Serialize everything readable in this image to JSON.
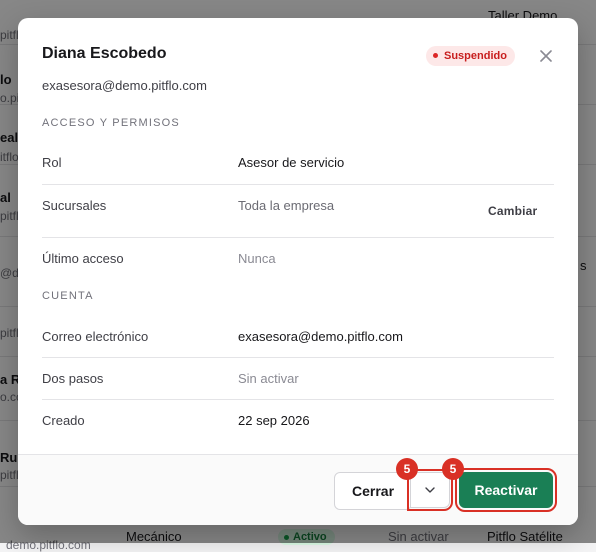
{
  "background": {
    "fragments": [
      {
        "id": "bg-top-right",
        "text": "Taller Demo"
      },
      {
        "id": "bg-l1",
        "text": "pitflo"
      },
      {
        "id": "bg-l2",
        "text": "lo"
      },
      {
        "id": "bg-l3",
        "text": "o.pitflo"
      },
      {
        "id": "bg-l4",
        "text": "eal"
      },
      {
        "id": "bg-l5",
        "text": "itflo"
      },
      {
        "id": "bg-l6",
        "text": "al"
      },
      {
        "id": "bg-l7",
        "text": "pitflo"
      },
      {
        "id": "bg-l8",
        "text": "@d"
      },
      {
        "id": "bg-l9",
        "text": "pitfl"
      },
      {
        "id": "bg-l10",
        "text": "a R"
      },
      {
        "id": "bg-l11",
        "text": "o.co"
      },
      {
        "id": "bg-l12",
        "text": "Ru"
      },
      {
        "id": "bg-l13",
        "text": "pitfl"
      },
      {
        "id": "bg-r1",
        "text": "s"
      },
      {
        "id": "bg-bottom-role",
        "text": "Mecánico"
      },
      {
        "id": "bg-bottom-access",
        "text": "Sin activar"
      },
      {
        "id": "bg-bottom-branch",
        "text": "Pitflo Satélite"
      },
      {
        "id": "bg-bottom-email",
        "text": "demo.pitflo.com"
      }
    ],
    "bottom_badge": "Activo"
  },
  "modal": {
    "name": "Diana Escobedo",
    "email": "exasesora@demo.pitflo.com",
    "status": "Suspendido",
    "sections": {
      "access_title": "ACCESO Y PERMISOS",
      "account_title": "CUENTA"
    },
    "access": {
      "role_label": "Rol",
      "role_value": "Asesor de servicio",
      "branches_label": "Sucursales",
      "branches_value": "Toda la empresa",
      "branches_action": "Cambiar",
      "last_access_label": "Último acceso",
      "last_access_value": "Nunca"
    },
    "account": {
      "email_label": "Correo electrónico",
      "email_value": "exasesora@demo.pitflo.com",
      "two_step_label": "Dos pasos",
      "two_step_value": "Sin activar",
      "created_label": "Creado",
      "created_value": "22 sep 2026"
    },
    "footer": {
      "close_label": "Cerrar",
      "reactivate_label": "Reactivar"
    },
    "markers": [
      "5",
      "5"
    ]
  },
  "colors": {
    "primary": "#1a7f55",
    "danger": "#d93025",
    "suspended_bg": "#fde8e8",
    "suspended_text": "#c81e1e"
  },
  "icons": {
    "close": "close-icon",
    "chevron": "chevron-down-icon"
  }
}
